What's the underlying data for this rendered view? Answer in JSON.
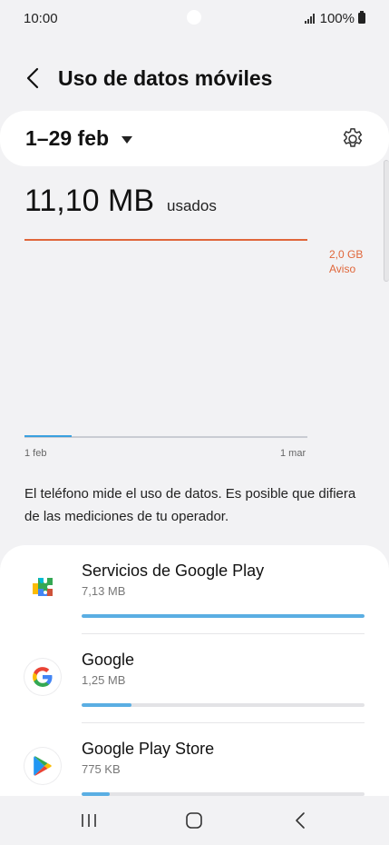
{
  "status_bar": {
    "time": "10:00",
    "battery": "100%"
  },
  "header": {
    "title": "Uso de datos móviles"
  },
  "period": {
    "label": "1–29 feb"
  },
  "usage": {
    "amount": "11,10 MB",
    "unit_label": "usados"
  },
  "chart": {
    "warning_value": "2,0 GB",
    "warning_label": "Aviso",
    "x_start": "1 feb",
    "x_end": "1 mar",
    "line_color": "#e0663a",
    "trace_color": "#3aa0df"
  },
  "note": "El teléfono mide el uso de datos. Es posible que difiera de las mediciones de tu operador.",
  "apps": [
    {
      "name": "Servicios de Google Play",
      "size": "7,13 MB",
      "usage_fraction": 1.0,
      "icon": "google-play-services-icon"
    },
    {
      "name": "Google",
      "size": "1,25 MB",
      "usage_fraction": 0.175,
      "icon": "google-icon"
    },
    {
      "name": "Google Play Store",
      "size": "775 KB",
      "usage_fraction": 0.1,
      "icon": "google-play-store-icon"
    }
  ],
  "colors": {
    "accent": "#5aaee3",
    "warning": "#e0663a",
    "background": "#f2f2f4"
  }
}
